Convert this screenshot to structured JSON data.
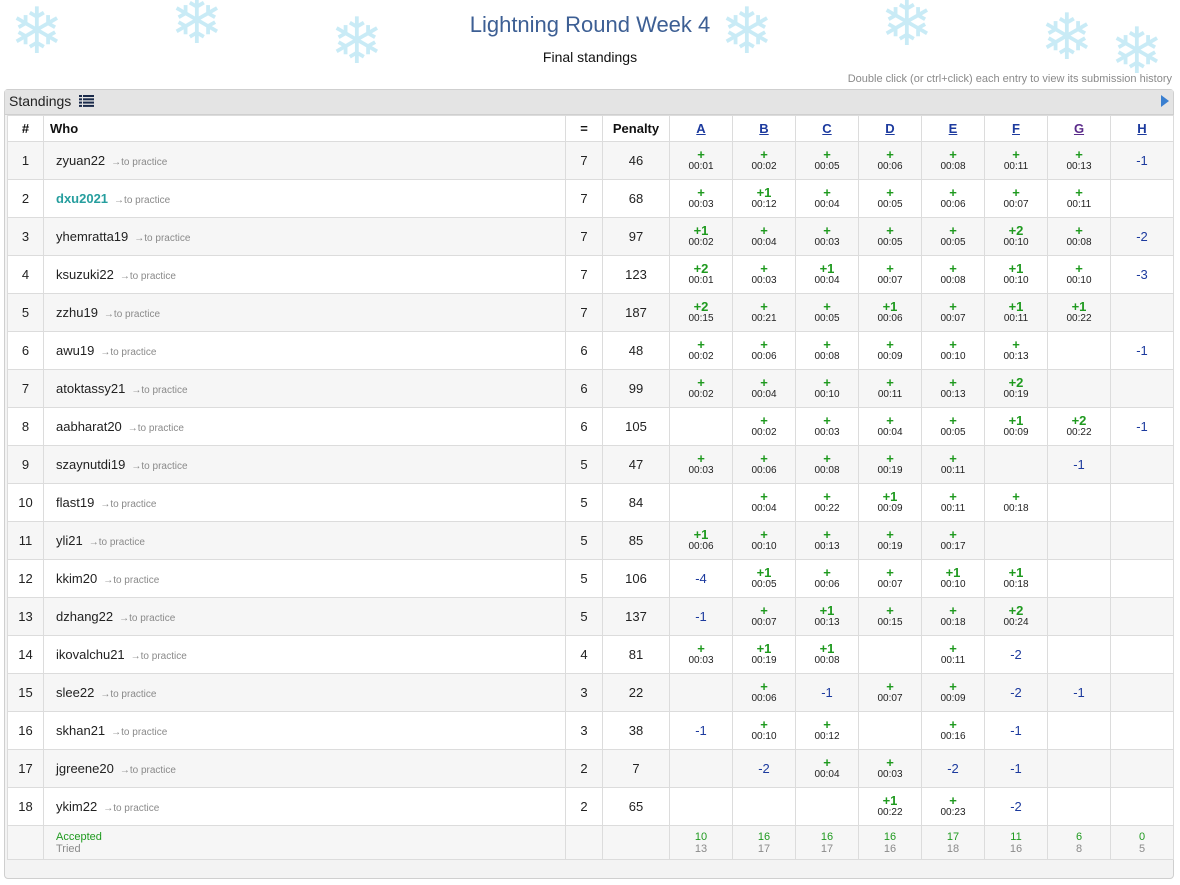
{
  "page": {
    "title": "Lightning Round Week 4",
    "subtitle": "Final standings",
    "hint": "Double click (or ctrl+click) each entry to view its submission history"
  },
  "panel": {
    "title": "Standings"
  },
  "columns": {
    "rank": "#",
    "who": "Who",
    "solved": "=",
    "penalty": "Penalty",
    "problems": [
      "A",
      "B",
      "C",
      "D",
      "E",
      "F",
      "G",
      "H"
    ]
  },
  "practice_label": "→to practice",
  "rows": [
    {
      "rank": "1",
      "name": "zyuan22",
      "highlight": false,
      "solved": "7",
      "penalty": "46",
      "cells": [
        [
          "+",
          "00:01"
        ],
        [
          "+",
          "00:02"
        ],
        [
          "+",
          "00:05"
        ],
        [
          "+",
          "00:06"
        ],
        [
          "+",
          "00:08"
        ],
        [
          "+",
          "00:11"
        ],
        [
          "+",
          "00:13"
        ],
        [
          "-1",
          ""
        ]
      ]
    },
    {
      "rank": "2",
      "name": "dxu2021",
      "highlight": true,
      "solved": "7",
      "penalty": "68",
      "cells": [
        [
          "+",
          "00:03"
        ],
        [
          "+1",
          "00:12"
        ],
        [
          "+",
          "00:04"
        ],
        [
          "+",
          "00:05"
        ],
        [
          "+",
          "00:06"
        ],
        [
          "+",
          "00:07"
        ],
        [
          "+",
          "00:11"
        ],
        [
          "",
          ""
        ]
      ]
    },
    {
      "rank": "3",
      "name": "yhemratta19",
      "highlight": false,
      "solved": "7",
      "penalty": "97",
      "cells": [
        [
          "+1",
          "00:02"
        ],
        [
          "+",
          "00:04"
        ],
        [
          "+",
          "00:03"
        ],
        [
          "+",
          "00:05"
        ],
        [
          "+",
          "00:05"
        ],
        [
          "+2",
          "00:10"
        ],
        [
          "+",
          "00:08"
        ],
        [
          "-2",
          ""
        ]
      ]
    },
    {
      "rank": "4",
      "name": "ksuzuki22",
      "highlight": false,
      "solved": "7",
      "penalty": "123",
      "cells": [
        [
          "+2",
          "00:01"
        ],
        [
          "+",
          "00:03"
        ],
        [
          "+1",
          "00:04"
        ],
        [
          "+",
          "00:07"
        ],
        [
          "+",
          "00:08"
        ],
        [
          "+1",
          "00:10"
        ],
        [
          "+",
          "00:10"
        ],
        [
          "-3",
          ""
        ]
      ]
    },
    {
      "rank": "5",
      "name": "zzhu19",
      "highlight": false,
      "solved": "7",
      "penalty": "187",
      "cells": [
        [
          "+2",
          "00:15"
        ],
        [
          "+",
          "00:21"
        ],
        [
          "+",
          "00:05"
        ],
        [
          "+1",
          "00:06"
        ],
        [
          "+",
          "00:07"
        ],
        [
          "+1",
          "00:11"
        ],
        [
          "+1",
          "00:22"
        ],
        [
          "",
          ""
        ]
      ]
    },
    {
      "rank": "6",
      "name": "awu19",
      "highlight": false,
      "solved": "6",
      "penalty": "48",
      "cells": [
        [
          "+",
          "00:02"
        ],
        [
          "+",
          "00:06"
        ],
        [
          "+",
          "00:08"
        ],
        [
          "+",
          "00:09"
        ],
        [
          "+",
          "00:10"
        ],
        [
          "+",
          "00:13"
        ],
        [
          "",
          ""
        ],
        [
          "-1",
          ""
        ]
      ]
    },
    {
      "rank": "7",
      "name": "atoktassy21",
      "highlight": false,
      "solved": "6",
      "penalty": "99",
      "cells": [
        [
          "+",
          "00:02"
        ],
        [
          "+",
          "00:04"
        ],
        [
          "+",
          "00:10"
        ],
        [
          "+",
          "00:11"
        ],
        [
          "+",
          "00:13"
        ],
        [
          "+2",
          "00:19"
        ],
        [
          "",
          ""
        ],
        [
          "",
          ""
        ]
      ]
    },
    {
      "rank": "8",
      "name": "aabharat20",
      "highlight": false,
      "solved": "6",
      "penalty": "105",
      "cells": [
        [
          "",
          ""
        ],
        [
          "+",
          "00:02"
        ],
        [
          "+",
          "00:03"
        ],
        [
          "+",
          "00:04"
        ],
        [
          "+",
          "00:05"
        ],
        [
          "+1",
          "00:09"
        ],
        [
          "+2",
          "00:22"
        ],
        [
          "-1",
          ""
        ]
      ]
    },
    {
      "rank": "9",
      "name": "szaynutdi19",
      "highlight": false,
      "solved": "5",
      "penalty": "47",
      "cells": [
        [
          "+",
          "00:03"
        ],
        [
          "+",
          "00:06"
        ],
        [
          "+",
          "00:08"
        ],
        [
          "+",
          "00:19"
        ],
        [
          "+",
          "00:11"
        ],
        [
          "",
          ""
        ],
        [
          "-1",
          ""
        ],
        [
          "",
          ""
        ]
      ]
    },
    {
      "rank": "10",
      "name": "flast19",
      "highlight": false,
      "solved": "5",
      "penalty": "84",
      "cells": [
        [
          "",
          ""
        ],
        [
          "+",
          "00:04"
        ],
        [
          "+",
          "00:22"
        ],
        [
          "+1",
          "00:09"
        ],
        [
          "+",
          "00:11"
        ],
        [
          "+",
          "00:18"
        ],
        [
          "",
          ""
        ],
        [
          "",
          ""
        ]
      ]
    },
    {
      "rank": "11",
      "name": "yli21",
      "highlight": false,
      "solved": "5",
      "penalty": "85",
      "cells": [
        [
          "+1",
          "00:06"
        ],
        [
          "+",
          "00:10"
        ],
        [
          "+",
          "00:13"
        ],
        [
          "+",
          "00:19"
        ],
        [
          "+",
          "00:17"
        ],
        [
          "",
          ""
        ],
        [
          "",
          ""
        ],
        [
          "",
          ""
        ]
      ]
    },
    {
      "rank": "12",
      "name": "kkim20",
      "highlight": false,
      "solved": "5",
      "penalty": "106",
      "cells": [
        [
          "-4",
          ""
        ],
        [
          "+1",
          "00:05"
        ],
        [
          "+",
          "00:06"
        ],
        [
          "+",
          "00:07"
        ],
        [
          "+1",
          "00:10"
        ],
        [
          "+1",
          "00:18"
        ],
        [
          "",
          ""
        ],
        [
          "",
          ""
        ]
      ]
    },
    {
      "rank": "13",
      "name": "dzhang22",
      "highlight": false,
      "solved": "5",
      "penalty": "137",
      "cells": [
        [
          "-1",
          ""
        ],
        [
          "+",
          "00:07"
        ],
        [
          "+1",
          "00:13"
        ],
        [
          "+",
          "00:15"
        ],
        [
          "+",
          "00:18"
        ],
        [
          "+2",
          "00:24"
        ],
        [
          "",
          ""
        ],
        [
          "",
          ""
        ]
      ]
    },
    {
      "rank": "14",
      "name": "ikovalchu21",
      "highlight": false,
      "solved": "4",
      "penalty": "81",
      "cells": [
        [
          "+",
          "00:03"
        ],
        [
          "+1",
          "00:19"
        ],
        [
          "+1",
          "00:08"
        ],
        [
          "",
          ""
        ],
        [
          "+",
          "00:11"
        ],
        [
          "-2",
          ""
        ],
        [
          "",
          ""
        ],
        [
          "",
          ""
        ]
      ]
    },
    {
      "rank": "15",
      "name": "slee22",
      "highlight": false,
      "solved": "3",
      "penalty": "22",
      "cells": [
        [
          "",
          ""
        ],
        [
          "+",
          "00:06"
        ],
        [
          "-1",
          ""
        ],
        [
          "+",
          "00:07"
        ],
        [
          "+",
          "00:09"
        ],
        [
          "-2",
          ""
        ],
        [
          "-1",
          ""
        ],
        [
          "",
          ""
        ]
      ]
    },
    {
      "rank": "16",
      "name": "skhan21",
      "highlight": false,
      "solved": "3",
      "penalty": "38",
      "cells": [
        [
          "-1",
          ""
        ],
        [
          "+",
          "00:10"
        ],
        [
          "+",
          "00:12"
        ],
        [
          "",
          ""
        ],
        [
          "+",
          "00:16"
        ],
        [
          "-1",
          ""
        ],
        [
          "",
          ""
        ],
        [
          "",
          ""
        ]
      ]
    },
    {
      "rank": "17",
      "name": "jgreene20",
      "highlight": false,
      "solved": "2",
      "penalty": "7",
      "cells": [
        [
          "",
          ""
        ],
        [
          "-2",
          ""
        ],
        [
          "+",
          "00:04"
        ],
        [
          "+",
          "00:03"
        ],
        [
          "-2",
          ""
        ],
        [
          "-1",
          ""
        ],
        [
          "",
          ""
        ],
        [
          "",
          ""
        ]
      ]
    },
    {
      "rank": "18",
      "name": "ykim22",
      "highlight": false,
      "solved": "2",
      "penalty": "65",
      "cells": [
        [
          "",
          ""
        ],
        [
          "",
          ""
        ],
        [
          "",
          ""
        ],
        [
          "+1",
          "00:22"
        ],
        [
          "+",
          "00:23"
        ],
        [
          "-2",
          ""
        ],
        [
          "",
          ""
        ],
        [
          "",
          ""
        ]
      ]
    }
  ],
  "summary": {
    "accepted_label": "Accepted",
    "tried_label": "Tried",
    "accepted": [
      "10",
      "16",
      "16",
      "16",
      "17",
      "11",
      "6",
      "0"
    ],
    "tried": [
      "13",
      "17",
      "17",
      "16",
      "18",
      "16",
      "8",
      "5"
    ]
  },
  "colors": {
    "accepted": "#1f9a1f",
    "failed": "#1c3a9e",
    "title": "#3d5f94",
    "highlight_name": "#269e9e"
  },
  "icons": {
    "panel_icon": "list-icon",
    "expand_icon": "expand-arrow-icon",
    "background": "snowflake-icon"
  }
}
